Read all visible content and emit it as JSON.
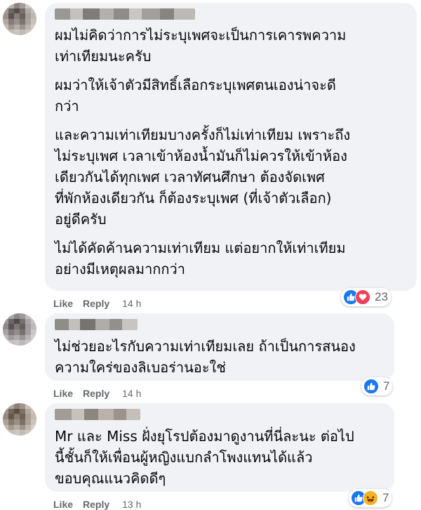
{
  "comments": [
    {
      "paragraphs": [
        [
          "ผมไม่คิดว่าการไม่ระบุเพศจะเป็นการเคารพความ",
          "เท่าเทียมนะครับ"
        ],
        [
          "ผมว่าให้เจ้าตัวมีสิทธิ์เลือกระบุเพศตนเองน่าจะดี",
          "กว่า"
        ],
        [
          "และความเท่าเทียมบางครั้งก็ไม่เท่าเทียม เพราะถึง",
          "ไม่ระบุเพศ เวลาเข้าห้องน้ำมันก็ไม่ควรให้เข้าห้อง",
          "เดียวกันได้ทุกเพศ เวลาทัศนศึกษา ต้องจัดเพศ",
          "ที่พักห้องเดียวกัน ก็ต้องระบุเพศ (ที่เจ้าตัวเลือก)",
          "อยู่ดีครับ"
        ],
        [
          "ไม่ได้คัดค้านความเท่าเทียม แต่อยากให้เท่าเทียม",
          "อย่างมีเหตุผลมากกว่า"
        ]
      ],
      "like": "Like",
      "reply": "Reply",
      "time": "14 h",
      "reactions": [
        "like-icon",
        "love-icon"
      ],
      "reaction_count": "23"
    },
    {
      "paragraphs": [
        [
          "ไม่ช่วยอะไรกับความเท่าเทียมเลย ถ้าเป็นการสนอง",
          "ความใคร่ของลิเบอร่านอะใช่"
        ]
      ],
      "like": "Like",
      "reply": "Reply",
      "time": "14 h",
      "reactions": [
        "like-icon"
      ],
      "reaction_count": "7"
    },
    {
      "paragraphs": [
        [
          "Mr และ Miss ฝั่งยุโรปต้องมาดูงานที่นี่ละนะ ต่อไป",
          "นี้ชั้นก็ให้เพื่อนผู้หญิงแบกลำโพงแทนได้แล้ว",
          "ขอบคุณแนวคิดดีๆ"
        ]
      ],
      "like": "Like",
      "reply": "Reply",
      "time": "13 h",
      "reactions": [
        "like-icon",
        "haha-icon"
      ],
      "reaction_count": "7"
    }
  ],
  "colors": {
    "bubble": "#f0f2f5",
    "action_text": "#65676b",
    "like_blue": "#1877f2",
    "love_red": "#f33e58",
    "haha_yellow": "#f7b125"
  }
}
